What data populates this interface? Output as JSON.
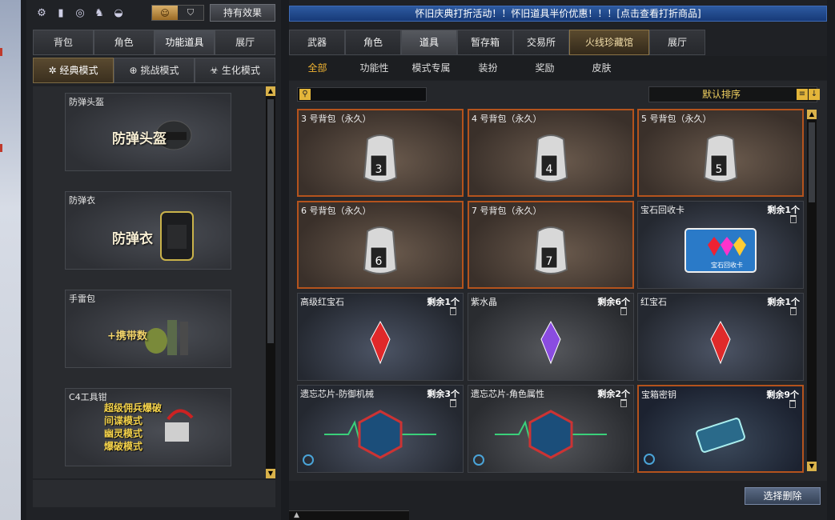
{
  "left": {
    "icon_bar": [
      {
        "icon": "off-toggle-icon",
        "glyph": "⚙"
      },
      {
        "icon": "bar-chart-icon",
        "glyph": "▮"
      },
      {
        "icon": "swirl-icon",
        "glyph": "◎"
      },
      {
        "icon": "character-icon",
        "glyph": "♞"
      },
      {
        "icon": "mouse-icon",
        "glyph": "◒"
      }
    ],
    "hold_effect_label": "持有效果",
    "top_tabs": [
      "背包",
      "角色",
      "功能道具",
      "展厅"
    ],
    "mode_tabs": [
      {
        "label": "经典模式",
        "icon": "star-icon",
        "glyph": "✲"
      },
      {
        "label": "挑战模式",
        "icon": "crosshair-icon",
        "glyph": "⊕"
      },
      {
        "label": "生化模式",
        "icon": "biohazard-icon",
        "glyph": "☣"
      }
    ],
    "slots": [
      {
        "label": "防弹头盔",
        "art_text": "防弹头盔"
      },
      {
        "label": "防弹衣",
        "art_text": "防弹衣"
      },
      {
        "label": "手雷包",
        "art_text": "+携带数"
      },
      {
        "label": "C4工具钳",
        "art_lines": [
          "超级佣兵爆破",
          "间谍模式",
          "幽灵模式",
          "爆破模式"
        ]
      }
    ]
  },
  "right": {
    "banner": "怀旧庆典打折活动！！怀旧道具半价优惠！！！[点击查看打折商品]",
    "tabs": [
      "武器",
      "角色",
      "道具",
      "暂存箱",
      "交易所",
      "火线珍藏馆",
      "展厅"
    ],
    "subtabs": [
      "全部",
      "功能性",
      "模式专属",
      "装扮",
      "奖励",
      "皮肤"
    ],
    "search_placeholder": "",
    "sort_label": "默认排序",
    "items": [
      {
        "name": "3 号背包（永久）",
        "count": "",
        "kind": "bag",
        "num": "3"
      },
      {
        "name": "4 号背包（永久）",
        "count": "",
        "kind": "bag",
        "num": "4"
      },
      {
        "name": "5 号背包（永久）",
        "count": "",
        "kind": "bag",
        "num": "5"
      },
      {
        "name": "6 号背包（永久）",
        "count": "",
        "kind": "bag",
        "num": "6"
      },
      {
        "name": "7 号背包（永久）",
        "count": "",
        "kind": "bag",
        "num": "7"
      },
      {
        "name": "宝石回收卡",
        "count": "剩余1个",
        "kind": "card",
        "card_text": "宝石回收卡"
      },
      {
        "name": "高级红宝石",
        "count": "剩余1个",
        "kind": "gem",
        "color": "#e0282a"
      },
      {
        "name": "紫水晶",
        "count": "剩余6个",
        "kind": "gem",
        "color": "#8a4ce0"
      },
      {
        "name": "红宝石",
        "count": "剩余1个",
        "kind": "gem",
        "color": "#e02a2a"
      },
      {
        "name": "遗忘芯片-防御机械",
        "count": "剩余3个",
        "kind": "chip"
      },
      {
        "name": "遗忘芯片-角色属性",
        "count": "剩余2个",
        "kind": "chip"
      },
      {
        "name": "宝箱密钥",
        "count": "剩余9个",
        "kind": "key"
      }
    ],
    "delete_button": "选择删除",
    "bottom_strip_text": "▲"
  }
}
